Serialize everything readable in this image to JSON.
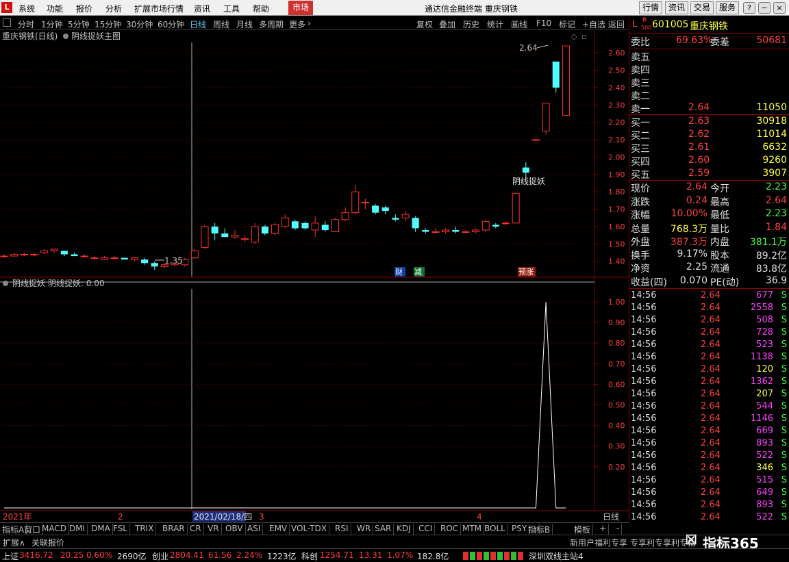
{
  "window": {
    "logo": "L",
    "title": "通达信金融终端  重庆钢铁",
    "menu": [
      "系统",
      "功能",
      "报价",
      "分析",
      "扩展市场行情",
      "资讯",
      "工具",
      "帮助"
    ],
    "market_button": "市场",
    "right_tabs": [
      "行情",
      "资讯",
      "交易",
      "服务"
    ]
  },
  "period_bar": {
    "periods": [
      "分时",
      "1分钟",
      "5分钟",
      "15分钟",
      "30分钟",
      "60分钟",
      "日线",
      "周线",
      "月线",
      "多周期",
      "更多"
    ],
    "active": "日线",
    "tools": [
      "复权",
      "叠加",
      "历史",
      "统计",
      "画线",
      "F10",
      "标记",
      "+自选",
      "返回"
    ]
  },
  "main_chart": {
    "title": "重庆钢铁(日线)",
    "formula": "阴线捉妖主图",
    "high_label": "2.64",
    "low_label": "1.35",
    "signal_label": "阴线捉妖",
    "events": [
      {
        "label": "财",
        "color": "#1060e0"
      },
      {
        "label": "减",
        "color": "#20a040"
      },
      {
        "label": "预涨",
        "color": "#c04020"
      }
    ],
    "y_ticks": [
      "2.60",
      "2.50",
      "2.40",
      "2.30",
      "2.20",
      "2.10",
      "2.00",
      "1.90",
      "1.80",
      "1.70",
      "1.60",
      "1.50",
      "1.40"
    ]
  },
  "indicator_chart": {
    "title": "阴线捉妖",
    "value_label": "阴线捉妖: 0.00",
    "y_ticks": [
      "1.00",
      "0.90",
      "0.80",
      "0.70",
      "0.60",
      "0.50",
      "0.40",
      "0.30",
      "0.20"
    ]
  },
  "time_axis": {
    "year": "2021年",
    "m2": "2",
    "cursor": "2021/02/18/四",
    "m3": "3",
    "m4": "4",
    "period": "日线"
  },
  "chart_data": {
    "type": "candlestick",
    "title": "重庆钢铁(日线)",
    "ylim": [
      1.32,
      2.66
    ],
    "candles": [
      {
        "o": 1.43,
        "h": 1.44,
        "l": 1.42,
        "c": 1.43
      },
      {
        "o": 1.43,
        "h": 1.45,
        "l": 1.43,
        "c": 1.44
      },
      {
        "o": 1.44,
        "h": 1.45,
        "l": 1.43,
        "c": 1.44
      },
      {
        "o": 1.44,
        "h": 1.45,
        "l": 1.43,
        "c": 1.44
      },
      {
        "o": 1.45,
        "h": 1.47,
        "l": 1.44,
        "c": 1.46
      },
      {
        "o": 1.46,
        "h": 1.47,
        "l": 1.45,
        "c": 1.47
      },
      {
        "o": 1.46,
        "h": 1.46,
        "l": 1.43,
        "c": 1.44
      },
      {
        "o": 1.44,
        "h": 1.45,
        "l": 1.43,
        "c": 1.43
      },
      {
        "o": 1.43,
        "h": 1.44,
        "l": 1.42,
        "c": 1.43
      },
      {
        "o": 1.42,
        "h": 1.43,
        "l": 1.41,
        "c": 1.42
      },
      {
        "o": 1.41,
        "h": 1.43,
        "l": 1.41,
        "c": 1.42
      },
      {
        "o": 1.42,
        "h": 1.43,
        "l": 1.41,
        "c": 1.42
      },
      {
        "o": 1.42,
        "h": 1.42,
        "l": 1.41,
        "c": 1.41
      },
      {
        "o": 1.41,
        "h": 1.42,
        "l": 1.4,
        "c": 1.42
      },
      {
        "o": 1.41,
        "h": 1.42,
        "l": 1.38,
        "c": 1.39
      },
      {
        "o": 1.39,
        "h": 1.4,
        "l": 1.35,
        "c": 1.37
      },
      {
        "o": 1.37,
        "h": 1.39,
        "l": 1.36,
        "c": 1.38
      },
      {
        "o": 1.38,
        "h": 1.39,
        "l": 1.37,
        "c": 1.39
      },
      {
        "o": 1.38,
        "h": 1.42,
        "l": 1.37,
        "c": 1.41
      },
      {
        "o": 1.42,
        "h": 1.47,
        "l": 1.41,
        "c": 1.46
      },
      {
        "o": 1.48,
        "h": 1.61,
        "l": 1.47,
        "c": 1.6
      },
      {
        "o": 1.6,
        "h": 1.62,
        "l": 1.52,
        "c": 1.56
      },
      {
        "o": 1.56,
        "h": 1.59,
        "l": 1.54,
        "c": 1.54
      },
      {
        "o": 1.54,
        "h": 1.58,
        "l": 1.53,
        "c": 1.55
      },
      {
        "o": 1.53,
        "h": 1.55,
        "l": 1.51,
        "c": 1.53
      },
      {
        "o": 1.51,
        "h": 1.62,
        "l": 1.5,
        "c": 1.6
      },
      {
        "o": 1.6,
        "h": 1.61,
        "l": 1.55,
        "c": 1.56
      },
      {
        "o": 1.56,
        "h": 1.62,
        "l": 1.55,
        "c": 1.61
      },
      {
        "o": 1.6,
        "h": 1.67,
        "l": 1.59,
        "c": 1.65
      },
      {
        "o": 1.63,
        "h": 1.64,
        "l": 1.58,
        "c": 1.59
      },
      {
        "o": 1.62,
        "h": 1.63,
        "l": 1.58,
        "c": 1.59
      },
      {
        "o": 1.58,
        "h": 1.66,
        "l": 1.54,
        "c": 1.62
      },
      {
        "o": 1.61,
        "h": 1.63,
        "l": 1.57,
        "c": 1.58
      },
      {
        "o": 1.57,
        "h": 1.65,
        "l": 1.57,
        "c": 1.64
      },
      {
        "o": 1.64,
        "h": 1.71,
        "l": 1.63,
        "c": 1.68
      },
      {
        "o": 1.68,
        "h": 1.84,
        "l": 1.67,
        "c": 1.8
      },
      {
        "o": 1.74,
        "h": 1.76,
        "l": 1.7,
        "c": 1.74
      },
      {
        "o": 1.72,
        "h": 1.73,
        "l": 1.67,
        "c": 1.68
      },
      {
        "o": 1.71,
        "h": 1.72,
        "l": 1.67,
        "c": 1.69
      },
      {
        "o": 1.65,
        "h": 1.67,
        "l": 1.63,
        "c": 1.64
      },
      {
        "o": 1.65,
        "h": 1.69,
        "l": 1.63,
        "c": 1.67
      },
      {
        "o": 1.65,
        "h": 1.66,
        "l": 1.57,
        "c": 1.59
      },
      {
        "o": 1.58,
        "h": 1.59,
        "l": 1.56,
        "c": 1.57
      },
      {
        "o": 1.57,
        "h": 1.59,
        "l": 1.56,
        "c": 1.57
      },
      {
        "o": 1.57,
        "h": 1.59,
        "l": 1.56,
        "c": 1.58
      },
      {
        "o": 1.58,
        "h": 1.6,
        "l": 1.56,
        "c": 1.57
      },
      {
        "o": 1.57,
        "h": 1.58,
        "l": 1.56,
        "c": 1.57
      },
      {
        "o": 1.57,
        "h": 1.59,
        "l": 1.56,
        "c": 1.58
      },
      {
        "o": 1.58,
        "h": 1.64,
        "l": 1.57,
        "c": 1.63
      },
      {
        "o": 1.61,
        "h": 1.62,
        "l": 1.59,
        "c": 1.6
      },
      {
        "o": 1.62,
        "h": 1.63,
        "l": 1.61,
        "c": 1.62
      },
      {
        "o": 1.62,
        "h": 1.8,
        "l": 1.62,
        "c": 1.79
      },
      {
        "o": 1.94,
        "h": 1.97,
        "l": 1.88,
        "c": 1.91
      },
      {
        "o": 2.1,
        "h": 2.1,
        "l": 2.1,
        "c": 2.1
      },
      {
        "o": 2.15,
        "h": 2.31,
        "l": 2.13,
        "c": 2.31
      },
      {
        "o": 2.55,
        "h": 2.55,
        "l": 2.37,
        "c": 2.4
      },
      {
        "o": 2.24,
        "h": 2.64,
        "l": 2.24,
        "c": 2.64
      }
    ],
    "indicator": {
      "name": "阴线捉妖",
      "ylim": [
        0,
        1.05
      ],
      "values_last": [
        0,
        0,
        0,
        0,
        0,
        1,
        0,
        0
      ]
    }
  },
  "quote": {
    "code": "601005",
    "name": "重庆钢铁",
    "r_badge": "R",
    "r_sub": "500",
    "weibi_label": "委比",
    "weibi": "69.63%",
    "weicha_label": "委差",
    "weicha": "50681",
    "asks": [
      {
        "label": "卖五",
        "price": "",
        "vol": ""
      },
      {
        "label": "卖四",
        "price": "",
        "vol": ""
      },
      {
        "label": "卖三",
        "price": "",
        "vol": ""
      },
      {
        "label": "卖二",
        "price": "",
        "vol": ""
      },
      {
        "label": "卖一",
        "price": "2.64",
        "vol": "11050"
      }
    ],
    "bids": [
      {
        "label": "买一",
        "price": "2.63",
        "vol": "30918"
      },
      {
        "label": "买二",
        "price": "2.62",
        "vol": "11014"
      },
      {
        "label": "买三",
        "price": "2.61",
        "vol": "6632"
      },
      {
        "label": "买四",
        "price": "2.60",
        "vol": "9260"
      },
      {
        "label": "买五",
        "price": "2.59",
        "vol": "3907"
      }
    ],
    "stats": [
      {
        "l1": "现价",
        "v1": "2.64",
        "c1": "red",
        "l2": "今开",
        "v2": "2.23",
        "c2": "green"
      },
      {
        "l1": "涨跌",
        "v1": "0.24",
        "c1": "red",
        "l2": "最高",
        "v2": "2.64",
        "c2": "red"
      },
      {
        "l1": "涨幅",
        "v1": "10.00%",
        "c1": "red",
        "l2": "最低",
        "v2": "2.23",
        "c2": "green"
      },
      {
        "l1": "总量",
        "v1": "768.3万",
        "c1": "yellow",
        "l2": "量比",
        "v2": "1.84",
        "c2": "red"
      },
      {
        "l1": "外盘",
        "v1": "387.3万",
        "c1": "red",
        "l2": "内盘",
        "v2": "381.1万",
        "c2": "green"
      },
      {
        "l1": "换手",
        "v1": "9.17%",
        "c1": "white",
        "l2": "股本",
        "v2": "89.2亿",
        "c2": "white"
      },
      {
        "l1": "净资",
        "v1": "2.25",
        "c1": "white",
        "l2": "流通",
        "v2": "83.8亿",
        "c2": "white"
      },
      {
        "l1": "收益(四)",
        "v1": "0.070",
        "c1": "white",
        "l2": "PE(动)",
        "v2": "36.9",
        "c2": "white"
      }
    ],
    "ticks": [
      {
        "t": "14:56",
        "p": "2.64",
        "v": "677",
        "c": "magenta",
        "s": "S"
      },
      {
        "t": "14:56",
        "p": "2.64",
        "v": "2558",
        "c": "magenta",
        "s": "S"
      },
      {
        "t": "14:56",
        "p": "2.64",
        "v": "508",
        "c": "magenta",
        "s": "S"
      },
      {
        "t": "14:56",
        "p": "2.64",
        "v": "728",
        "c": "magenta",
        "s": "S"
      },
      {
        "t": "14:56",
        "p": "2.64",
        "v": "523",
        "c": "magenta",
        "s": "S"
      },
      {
        "t": "14:56",
        "p": "2.64",
        "v": "1138",
        "c": "magenta",
        "s": "S"
      },
      {
        "t": "14:56",
        "p": "2.64",
        "v": "120",
        "c": "yellow",
        "s": "S"
      },
      {
        "t": "14:56",
        "p": "2.64",
        "v": "1362",
        "c": "magenta",
        "s": "S"
      },
      {
        "t": "14:56",
        "p": "2.64",
        "v": "207",
        "c": "yellow",
        "s": "S"
      },
      {
        "t": "14:56",
        "p": "2.64",
        "v": "544",
        "c": "magenta",
        "s": "S"
      },
      {
        "t": "14:56",
        "p": "2.64",
        "v": "1146",
        "c": "magenta",
        "s": "S"
      },
      {
        "t": "14:56",
        "p": "2.64",
        "v": "669",
        "c": "magenta",
        "s": "S"
      },
      {
        "t": "14:56",
        "p": "2.64",
        "v": "893",
        "c": "magenta",
        "s": "S"
      },
      {
        "t": "14:56",
        "p": "2.64",
        "v": "522",
        "c": "magenta",
        "s": "S"
      },
      {
        "t": "14:56",
        "p": "2.64",
        "v": "346",
        "c": "yellow",
        "s": "S"
      },
      {
        "t": "14:56",
        "p": "2.64",
        "v": "515",
        "c": "magenta",
        "s": "S"
      },
      {
        "t": "14:56",
        "p": "2.64",
        "v": "649",
        "c": "magenta",
        "s": "S"
      },
      {
        "t": "14:56",
        "p": "2.64",
        "v": "893",
        "c": "magenta",
        "s": "S"
      },
      {
        "t": "14:56",
        "p": "2.64",
        "v": "522",
        "c": "magenta",
        "s": "S"
      }
    ]
  },
  "indicator_tabs": [
    "指标A",
    "窗口",
    "MACD",
    "DMI",
    "DMA",
    "FSL",
    "TRIX",
    "BRAR",
    "CR",
    "VR",
    "OBV",
    "ASI",
    "EMV",
    "VOL-TDX",
    "RSI",
    "WR",
    "SAR",
    "KDJ",
    "CCI",
    "ROC",
    "MTM",
    "BOLL",
    "PSY"
  ],
  "indicator_tabs_right": [
    "指标B",
    "模板",
    "+",
    "-"
  ],
  "status": {
    "expand": "扩展∧",
    "related": "关联报价",
    "news1": "新用户福利专享",
    "news2": "专享利专享利专指",
    "watermark": "指标365"
  },
  "index_bar": {
    "sh_label": "上证",
    "sh_val": "3416.72",
    "sh_chg": "20.25",
    "sh_pct": "0.60%",
    "sh_amt": "2690亿",
    "cy_label": "创业",
    "cy_val": "2804.41",
    "cy_chg": "61.56",
    "cy_pct": "2.24%",
    "cy_amt": "1223亿",
    "kc_label": "科创",
    "kc_val": "1254.71",
    "kc_chg": "13.31",
    "kc_pct": "1.07%",
    "kc_amt": "182.8亿",
    "server": "深圳双线主站4"
  }
}
